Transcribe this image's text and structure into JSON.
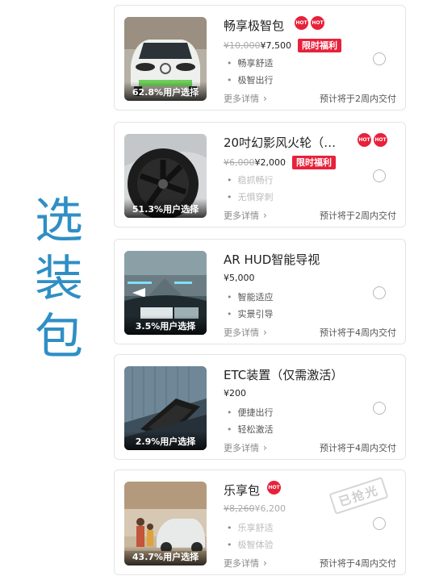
{
  "side_title": [
    "选",
    "装",
    "包"
  ],
  "more_label": "更多详情",
  "items": [
    {
      "name": "畅享极智包",
      "hot_label": "HOT",
      "hot_count": 2,
      "old_price": "¥10,000",
      "price": "¥7,500",
      "promo": "限时福利",
      "features": [
        "畅享舒适",
        "极智出行"
      ],
      "features_dimmed": false,
      "percent_label": "62.8%用户选择",
      "delivery": "预计将于2周内交付",
      "image": "white-ev-front"
    },
    {
      "name": "20吋幻影风火轮（…",
      "hot_label": "HOT",
      "hot_count": 2,
      "old_price": "¥6,000",
      "price": "¥2,000",
      "promo": "限时福利",
      "features": [
        "稳抓畅行",
        "无惧穿刺"
      ],
      "features_dimmed": true,
      "percent_label": "51.3%用户选择",
      "delivery": "预计将于2周内交付",
      "image": "alloy-wheel"
    },
    {
      "name": "AR HUD智能导视",
      "hot_label": "",
      "hot_count": 0,
      "old_price": "",
      "price": "¥5,000",
      "promo": "",
      "features": [
        "智能适应",
        "实景引导"
      ],
      "features_dimmed": false,
      "percent_label": "3.5%用户选择",
      "delivery": "预计将于4周内交付",
      "image": "ar-hud-view"
    },
    {
      "name": "ETC装置（仅需激活）",
      "hot_label": "",
      "hot_count": 0,
      "old_price": "",
      "price": "¥200",
      "promo": "",
      "features": [
        "便捷出行",
        "轻松激活"
      ],
      "features_dimmed": false,
      "percent_label": "2.9%用户选择",
      "delivery": "预计将于4周内交付",
      "image": "etc-device"
    },
    {
      "name": "乐享包",
      "hot_label": "HOT",
      "hot_count": 1,
      "old_price": "¥8,260",
      "price": "¥6,200",
      "promo": "",
      "features": [
        "乐享舒适",
        "极智体验"
      ],
      "features_dimmed": true,
      "percent_label": "43.7%用户选择",
      "delivery": "预计将于4周内交付",
      "image": "family-with-car",
      "stamp": "已抢光"
    }
  ]
}
